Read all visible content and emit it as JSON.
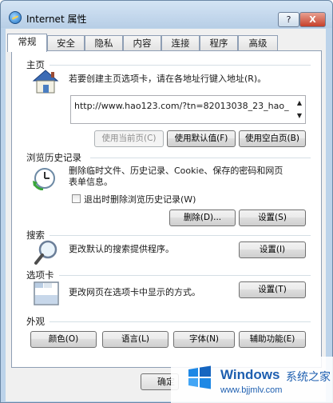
{
  "window": {
    "title": "Internet 属性",
    "help_label": "?",
    "close_label": "X"
  },
  "tabs": [
    {
      "label": "常规",
      "active": true
    },
    {
      "label": "安全"
    },
    {
      "label": "隐私"
    },
    {
      "label": "内容"
    },
    {
      "label": "连接"
    },
    {
      "label": "程序"
    },
    {
      "label": "高级"
    }
  ],
  "homepage": {
    "heading": "主页",
    "description": "若要创建主页选项卡，请在各地址行键入地址(R)。",
    "url": "http://www.hao123.com/?tn=82013038_23_hao_",
    "buttons": {
      "use_current": "使用当前页(C)",
      "use_default": "使用默认值(F)",
      "use_blank": "使用空白页(B)"
    }
  },
  "history": {
    "heading": "浏览历史记录",
    "description_line1": "删除临时文件、历史记录、Cookie、保存的密码和网页",
    "description_line2": "表单信息。",
    "checkbox_label": "退出时删除浏览历史记录(W)",
    "checkbox_checked": false,
    "delete_label": "删除(D)...",
    "settings_label": "设置(S)"
  },
  "search": {
    "heading": "搜索",
    "description": "更改默认的搜索提供程序。",
    "settings_label": "设置(I)"
  },
  "tabs_section": {
    "heading": "选项卡",
    "description": "更改网页在选项卡中显示的方式。",
    "settings_label": "设置(T)"
  },
  "appearance": {
    "heading": "外观",
    "buttons": [
      "颜色(O)",
      "语言(L)",
      "字体(N)",
      "辅助功能(E)"
    ]
  },
  "footer": {
    "ok_label": "确定"
  },
  "watermark": {
    "brand": "Windows",
    "brand_cn": "系统之家",
    "url": "www.bjjmlv.com"
  },
  "colors": {
    "titlebar": "#bcd3ea",
    "close_button": "#c6402a",
    "watermark_blue": "#1e5fb0"
  }
}
